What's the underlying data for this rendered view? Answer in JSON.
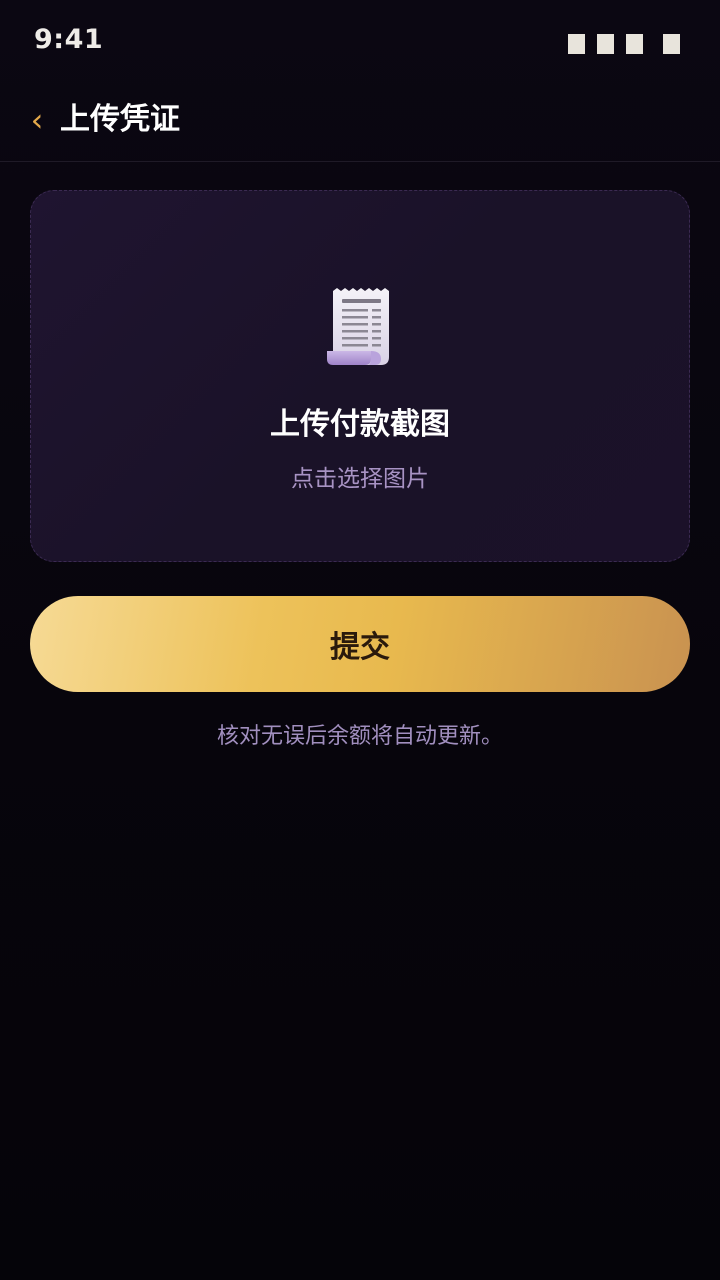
{
  "status_bar": {
    "time": "9:41"
  },
  "header": {
    "back_icon": "chevron-left-icon",
    "back_glyph": "‹",
    "title": "上传凭证"
  },
  "upload_card": {
    "icon": "receipt-icon",
    "title": "上传付款截图",
    "hint": "点击选择图片"
  },
  "submit": {
    "label": "提交"
  },
  "footnote": "核对无误后余额将自动更新。",
  "colors": {
    "accent": "#e3a84a",
    "button_gradient_start": "#f6da95",
    "button_gradient_end": "#c99250",
    "hint_text": "#a893c4",
    "background": "#07050c"
  }
}
